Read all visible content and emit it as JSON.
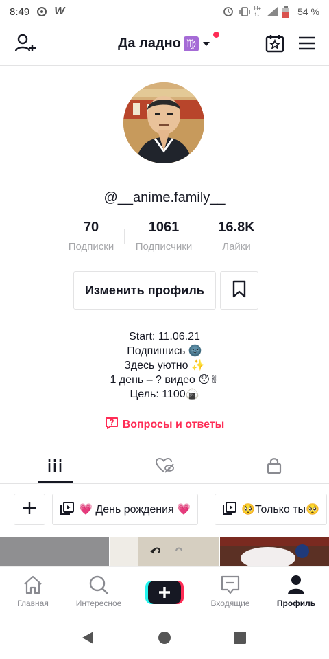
{
  "status_bar": {
    "time": "8:49",
    "battery": "54 %"
  },
  "header": {
    "title": "Да ладно",
    "title_badge": "♍"
  },
  "profile": {
    "username": "@__anime.family__",
    "stats": [
      {
        "value": "70",
        "label": "Подписки"
      },
      {
        "value": "1061",
        "label": "Подписчики"
      },
      {
        "value": "16.8K",
        "label": "Лайки"
      }
    ],
    "edit_label": "Изменить профиль",
    "bio": [
      "Start: 11.06.21",
      "Подпишись 🌚",
      "Здесь уютно ✨",
      "1 день – ? видео 😯✌",
      "Цель: 1100🍙"
    ],
    "qa_label": "Вопросы и ответы"
  },
  "playlists": [
    {
      "label": "💗 День рождения 💗"
    },
    {
      "label": "🥺Только ты🥺"
    }
  ],
  "bottom_nav": [
    {
      "label": "Главная",
      "icon": "home-icon"
    },
    {
      "label": "Интересное",
      "icon": "search-icon"
    },
    {
      "label": "",
      "icon": "plus-icon"
    },
    {
      "label": "Входящие",
      "icon": "inbox-icon"
    },
    {
      "label": "Профиль",
      "icon": "profile-icon"
    }
  ],
  "colors": {
    "accent": "#fe2c55",
    "text": "#161823",
    "muted": "#a7a8ab"
  }
}
